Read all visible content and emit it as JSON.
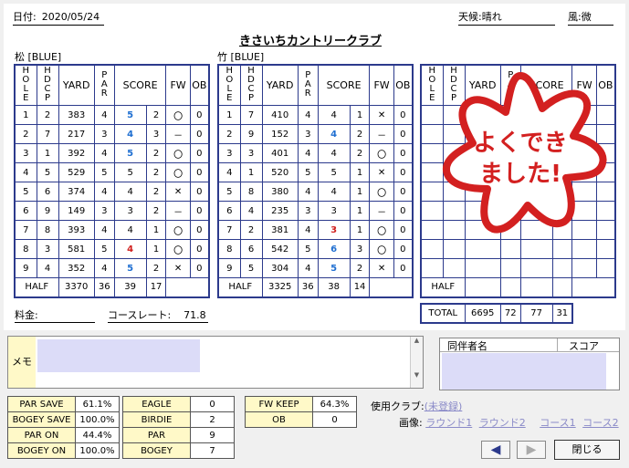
{
  "header": {
    "date_label": "日付:",
    "date": "2020/05/24",
    "club_name": "きさいちカントリークラブ",
    "weather_label": "天候:",
    "weather": "晴れ",
    "wind_label": "風:",
    "wind": "微"
  },
  "columns": {
    "hole": "HOLE",
    "hdcp": "HDCP",
    "yard": "YARD",
    "par": "PAR",
    "score": "SCORE",
    "fw": "FW",
    "ob": "OB"
  },
  "course1": {
    "label": "松 [BLUE]",
    "rows": [
      {
        "hole": "1",
        "hdcp": "2",
        "yard": "383",
        "par": "4",
        "score": "5",
        "putt": "2",
        "fw": "〇",
        "ob": "0",
        "color": "blue"
      },
      {
        "hole": "2",
        "hdcp": "7",
        "yard": "217",
        "par": "3",
        "score": "4",
        "putt": "3",
        "fw": "－",
        "ob": "0",
        "color": "blue"
      },
      {
        "hole": "3",
        "hdcp": "1",
        "yard": "392",
        "par": "4",
        "score": "5",
        "putt": "2",
        "fw": "〇",
        "ob": "0",
        "color": "blue"
      },
      {
        "hole": "4",
        "hdcp": "5",
        "yard": "529",
        "par": "5",
        "score": "5",
        "putt": "2",
        "fw": "〇",
        "ob": "0",
        "color": "black"
      },
      {
        "hole": "5",
        "hdcp": "6",
        "yard": "374",
        "par": "4",
        "score": "4",
        "putt": "2",
        "fw": "✕",
        "ob": "0",
        "color": "black"
      },
      {
        "hole": "6",
        "hdcp": "9",
        "yard": "149",
        "par": "3",
        "score": "3",
        "putt": "2",
        "fw": "－",
        "ob": "0",
        "color": "black"
      },
      {
        "hole": "7",
        "hdcp": "8",
        "yard": "393",
        "par": "4",
        "score": "4",
        "putt": "1",
        "fw": "〇",
        "ob": "0",
        "color": "black"
      },
      {
        "hole": "8",
        "hdcp": "3",
        "yard": "581",
        "par": "5",
        "score": "4",
        "putt": "1",
        "fw": "〇",
        "ob": "0",
        "color": "red"
      },
      {
        "hole": "9",
        "hdcp": "4",
        "yard": "352",
        "par": "4",
        "score": "5",
        "putt": "2",
        "fw": "✕",
        "ob": "0",
        "color": "blue"
      }
    ],
    "half": {
      "label": "HALF",
      "yard": "3370",
      "par": "36",
      "score": "39",
      "putt": "17"
    }
  },
  "course2": {
    "label": "竹 [BLUE]",
    "rows": [
      {
        "hole": "1",
        "hdcp": "7",
        "yard": "410",
        "par": "4",
        "score": "4",
        "putt": "1",
        "fw": "✕",
        "ob": "0",
        "color": "black"
      },
      {
        "hole": "2",
        "hdcp": "9",
        "yard": "152",
        "par": "3",
        "score": "4",
        "putt": "2",
        "fw": "－",
        "ob": "0",
        "color": "blue"
      },
      {
        "hole": "3",
        "hdcp": "3",
        "yard": "401",
        "par": "4",
        "score": "4",
        "putt": "2",
        "fw": "〇",
        "ob": "0",
        "color": "black"
      },
      {
        "hole": "4",
        "hdcp": "1",
        "yard": "520",
        "par": "5",
        "score": "5",
        "putt": "1",
        "fw": "✕",
        "ob": "0",
        "color": "black"
      },
      {
        "hole": "5",
        "hdcp": "8",
        "yard": "380",
        "par": "4",
        "score": "4",
        "putt": "1",
        "fw": "〇",
        "ob": "0",
        "color": "black"
      },
      {
        "hole": "6",
        "hdcp": "4",
        "yard": "235",
        "par": "3",
        "score": "3",
        "putt": "1",
        "fw": "－",
        "ob": "0",
        "color": "black"
      },
      {
        "hole": "7",
        "hdcp": "2",
        "yard": "381",
        "par": "4",
        "score": "3",
        "putt": "1",
        "fw": "〇",
        "ob": "0",
        "color": "red"
      },
      {
        "hole": "8",
        "hdcp": "6",
        "yard": "542",
        "par": "5",
        "score": "6",
        "putt": "3",
        "fw": "〇",
        "ob": "0",
        "color": "blue"
      },
      {
        "hole": "9",
        "hdcp": "5",
        "yard": "304",
        "par": "4",
        "score": "5",
        "putt": "2",
        "fw": "✕",
        "ob": "0",
        "color": "blue"
      }
    ],
    "half": {
      "label": "HALF",
      "yard": "3325",
      "par": "36",
      "score": "38",
      "putt": "14"
    }
  },
  "course3": {
    "half_label": "HALF",
    "total": {
      "label": "TOTAL",
      "yard": "6695",
      "par": "72",
      "score": "77",
      "putt": "31"
    }
  },
  "stamp": {
    "line1": "よくでき",
    "line2": "ました!",
    "color": "#d32020"
  },
  "fees": {
    "fee_label": "料金:",
    "fee": "",
    "rating_label": "コースレート:",
    "rating": "71.8"
  },
  "memo": {
    "label": "メモ"
  },
  "companions": {
    "name_header": "同伴者名",
    "score_header": "スコア"
  },
  "stats": {
    "left": [
      {
        "label": "PAR SAVE",
        "value": "61.1%"
      },
      {
        "label": "BOGEY SAVE",
        "value": "100.0%"
      },
      {
        "label": "PAR ON",
        "value": "44.4%"
      },
      {
        "label": "BOGEY ON",
        "value": "100.0%"
      }
    ],
    "mid": [
      {
        "label": "EAGLE",
        "value": "0"
      },
      {
        "label": "BIRDIE",
        "value": "2"
      },
      {
        "label": "PAR",
        "value": "9"
      },
      {
        "label": "BOGEY",
        "value": "7"
      }
    ],
    "right": [
      {
        "label": "FW KEEP",
        "value": "64.3%"
      },
      {
        "label": "OB",
        "value": "0"
      }
    ]
  },
  "clubs": {
    "label": "使用クラブ:",
    "unregistered": "(未登録)",
    "image_label": "画像:",
    "round1": "ラウンド1",
    "round2": "ラウンド2",
    "course1": "コース1",
    "course2": "コース2"
  },
  "buttons": {
    "prev": "◀",
    "next": "▶",
    "close": "閉じる"
  },
  "colors": {
    "grid": "#2c3a8c",
    "blue_score": "#1f6fd1",
    "red_score": "#d0201e",
    "field_fill": "#dcdcf8",
    "label_fill": "#fff9c8"
  }
}
